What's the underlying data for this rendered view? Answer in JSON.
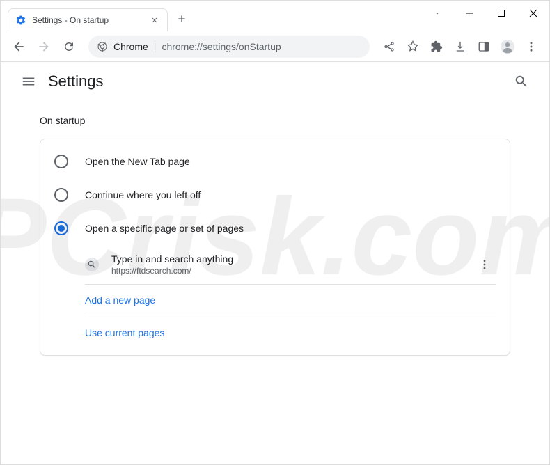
{
  "window": {
    "tab_title": "Settings - On startup"
  },
  "omnibox": {
    "label": "Chrome",
    "url": "chrome://settings/onStartup"
  },
  "appbar": {
    "title": "Settings"
  },
  "section": {
    "title": "On startup",
    "options": {
      "new_tab": "Open the New Tab page",
      "continue": "Continue where you left off",
      "specific": "Open a specific page or set of pages"
    },
    "page_entry": {
      "title": "Type in and search anything",
      "url": "https://ftdsearch.com/"
    },
    "links": {
      "add_page": "Add a new page",
      "use_current": "Use current pages"
    }
  }
}
